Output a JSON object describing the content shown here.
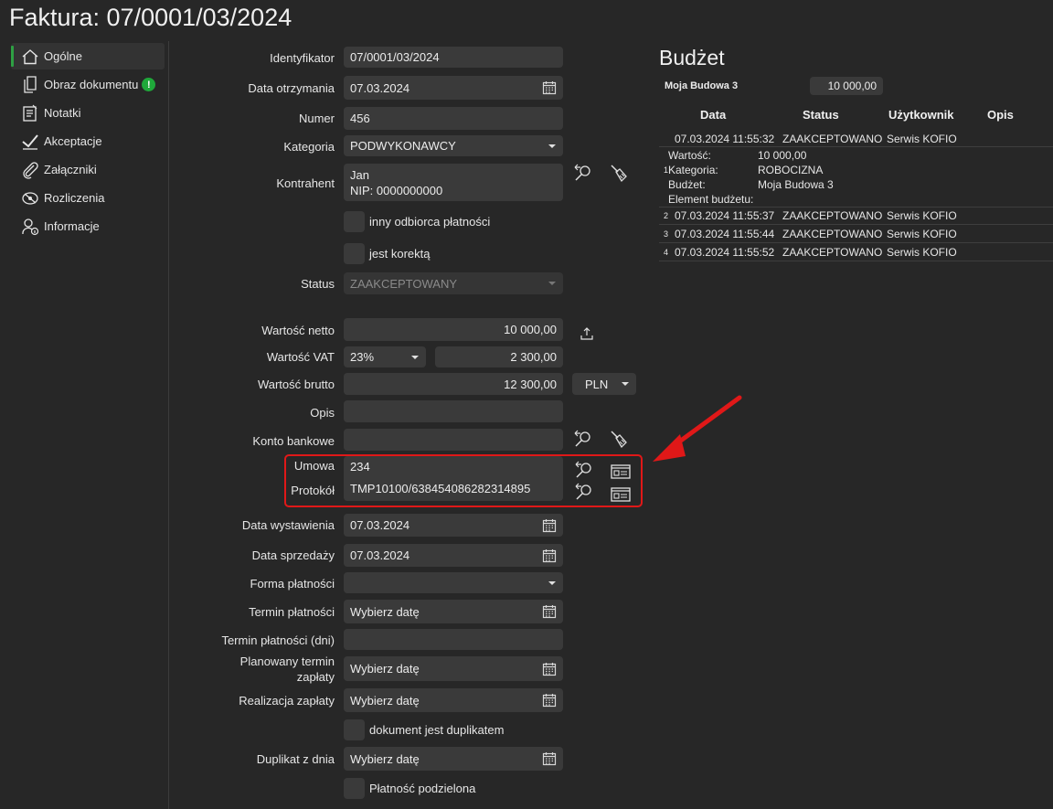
{
  "title": "Faktura: 07/0001/03/2024",
  "sidebar": {
    "items": [
      {
        "label": "Ogólne",
        "icon": "home-icon",
        "active": true
      },
      {
        "label": "Obraz dokumentu",
        "icon": "document-image-icon",
        "badge": "!"
      },
      {
        "label": "Notatki",
        "icon": "notes-icon"
      },
      {
        "label": "Akceptacje",
        "icon": "checkmark-icon"
      },
      {
        "label": "Załączniki",
        "icon": "paperclip-icon"
      },
      {
        "label": "Rozliczenia",
        "icon": "settlement-icon"
      },
      {
        "label": "Informacje",
        "icon": "user-info-icon"
      }
    ]
  },
  "form": {
    "identyfikator": {
      "label": "Identyfikator",
      "value": "07/0001/03/2024"
    },
    "data_otrzymania": {
      "label": "Data otrzymania",
      "value": "07.03.2024"
    },
    "numer": {
      "label": "Numer",
      "value": "456"
    },
    "kategoria": {
      "label": "Kategoria",
      "value": "PODWYKONAWCY"
    },
    "kontrahent": {
      "label": "Kontrahent",
      "line1": "Jan",
      "line2": "NIP: 0000000000"
    },
    "inny_odbiorca": {
      "label": "inny odbiorca płatności"
    },
    "jest_korekta": {
      "label": "jest korektą"
    },
    "status": {
      "label": "Status",
      "value": "ZAAKCEPTOWANY"
    },
    "wartosc_netto": {
      "label": "Wartość netto",
      "value": "10 000,00"
    },
    "wartosc_vat": {
      "label": "Wartość VAT",
      "rate": "23%",
      "value": "2 300,00"
    },
    "wartosc_brutto": {
      "label": "Wartość brutto",
      "value": "12 300,00",
      "currency": "PLN"
    },
    "opis": {
      "label": "Opis",
      "value": ""
    },
    "konto_bankowe": {
      "label": "Konto bankowe",
      "value": ""
    },
    "umowa": {
      "label": "Umowa",
      "value": "234"
    },
    "protokol": {
      "label": "Protokół",
      "value": "TMP10100/638454086282314895"
    },
    "data_wystawienia": {
      "label": "Data wystawienia",
      "value": "07.03.2024"
    },
    "data_sprzedazy": {
      "label": "Data sprzedaży",
      "value": "07.03.2024"
    },
    "forma_platnosci": {
      "label": "Forma płatności",
      "value": ""
    },
    "termin_platnosci": {
      "label": "Termin płatności",
      "placeholder": "Wybierz datę"
    },
    "termin_platnosci_dni": {
      "label": "Termin płatności (dni)",
      "value": ""
    },
    "planowany_termin": {
      "label1": "Planowany termin",
      "label2": "zapłaty",
      "placeholder": "Wybierz datę"
    },
    "realizacja": {
      "label": "Realizacja zapłaty",
      "placeholder": "Wybierz datę"
    },
    "duplikat_chk": {
      "label": "dokument jest duplikatem"
    },
    "duplikat_z_dnia": {
      "label": "Duplikat z dnia",
      "placeholder": "Wybierz datę"
    },
    "platnosc_podzielona": {
      "label": "Płatność podzielona"
    }
  },
  "budget": {
    "title": "Budżet",
    "name": "Moja Budowa 3",
    "amount": "10 000,00",
    "columns": [
      "Data",
      "Status",
      "Użytkownik",
      "Opis"
    ],
    "rows": [
      {
        "num": "1",
        "date": "07.03.2024 11:55:32",
        "status": "ZAAKCEPTOWANO",
        "user": "Serwis KOFIO",
        "details": [
          {
            "k": "Wartość:",
            "v": "10 000,00"
          },
          {
            "k": "Kategoria:",
            "v": "ROBOCIZNA"
          },
          {
            "k": "Budżet:",
            "v": "Moja Budowa 3"
          },
          {
            "k": "Element budżetu:",
            "v": ""
          }
        ]
      },
      {
        "num": "2",
        "date": "07.03.2024 11:55:37",
        "status": "ZAAKCEPTOWANO",
        "user": "Serwis KOFIO"
      },
      {
        "num": "3",
        "date": "07.03.2024 11:55:44",
        "status": "ZAAKCEPTOWANO",
        "user": "Serwis KOFIO"
      },
      {
        "num": "4",
        "date": "07.03.2024 11:55:52",
        "status": "ZAAKCEPTOWANO",
        "user": "Serwis KOFIO"
      }
    ]
  },
  "colors": {
    "accent": "#2ea043",
    "highlight": "#e01818",
    "arrow": "#e01818"
  }
}
